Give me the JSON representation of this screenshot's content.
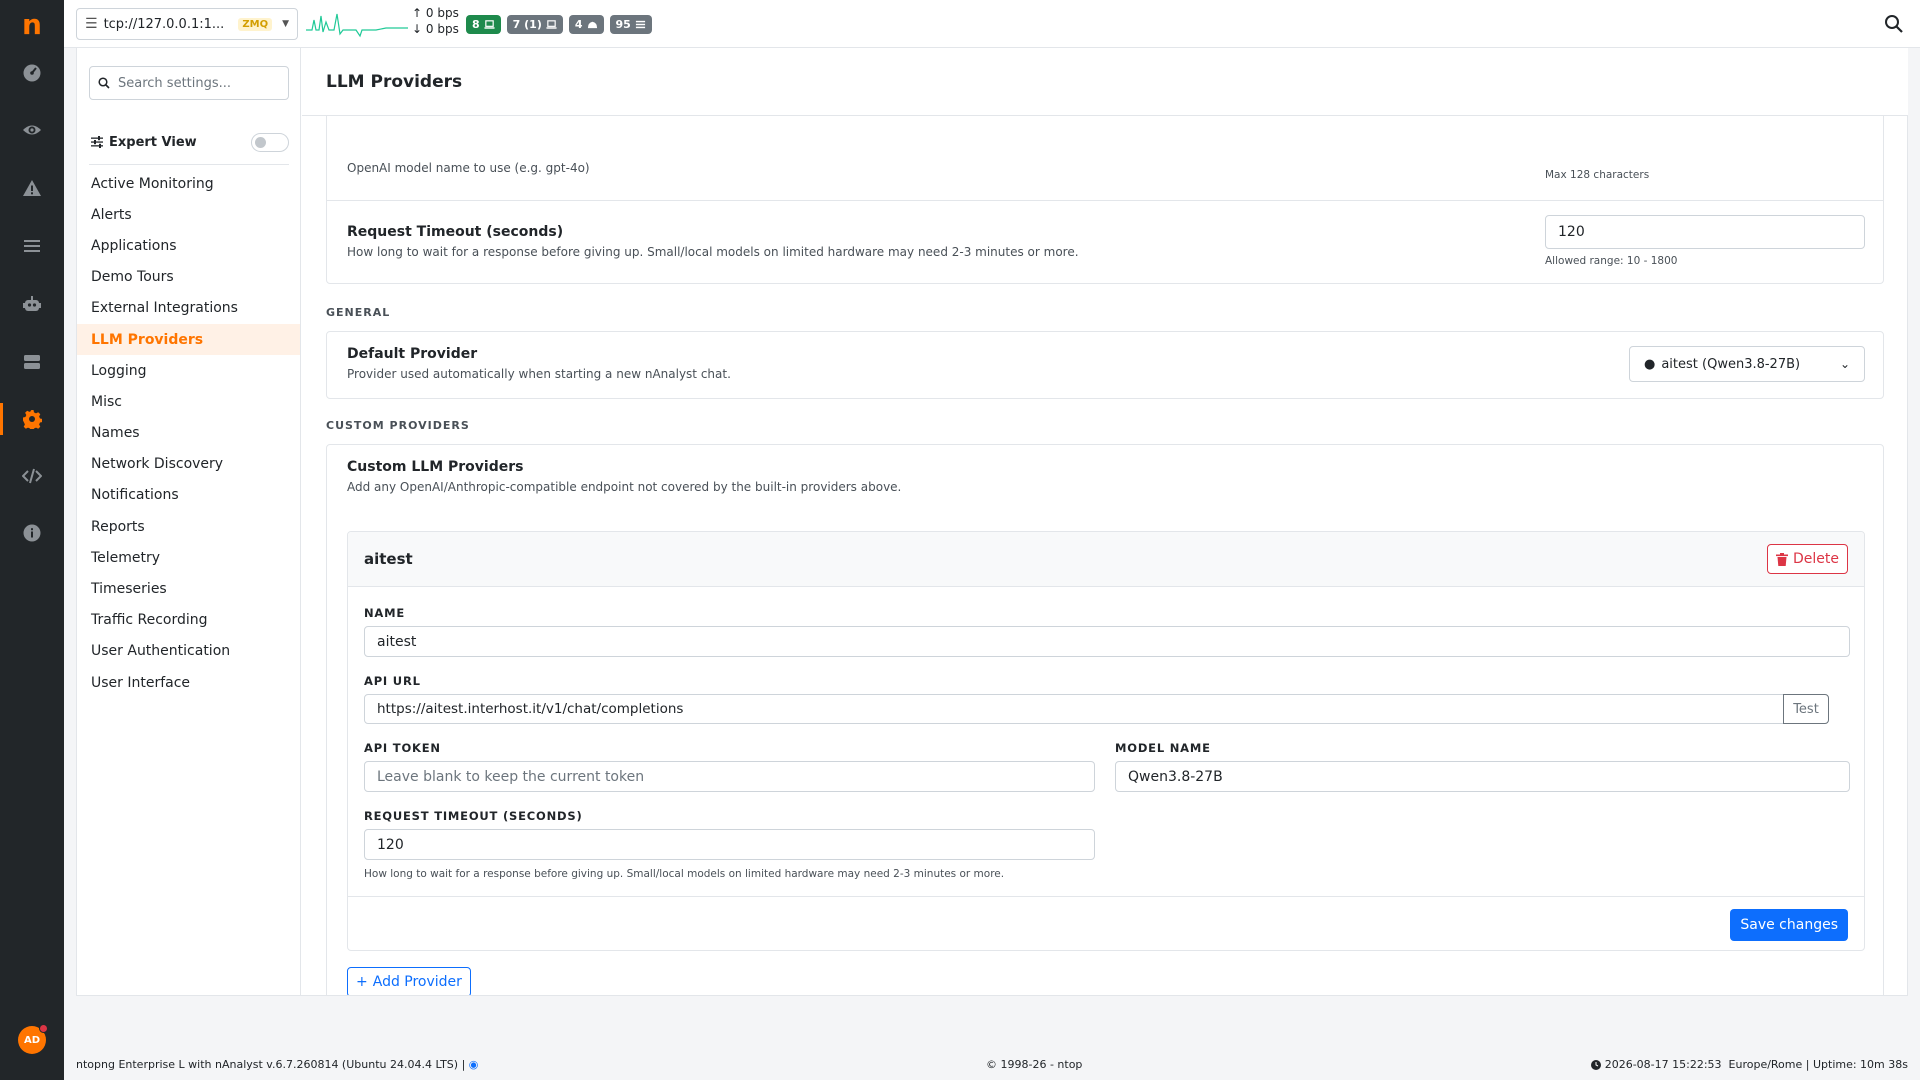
{
  "app": {
    "logo": "n",
    "avatar_initials": "AD"
  },
  "rail": {
    "icons": [
      "dashboard-icon",
      "eye-icon",
      "alert-icon",
      "list-icon",
      "robot-icon",
      "server-icon",
      "gear-icon",
      "code-icon",
      "info-icon"
    ],
    "active": "gear-icon",
    "accent_color": "#ff7500"
  },
  "topbar": {
    "interface": "tcp://127.0.0.1:1...",
    "interface_badge": "ZMQ",
    "upload": "0 bps",
    "download": "0 bps",
    "badges": [
      {
        "label": "8",
        "icon": "laptop-icon",
        "color": "#1e8a4c"
      },
      {
        "label": "7 (1)",
        "icon": "laptop-icon",
        "color": "#6c757d"
      },
      {
        "label": "4",
        "icon": "cloud-icon",
        "color": "#6c757d"
      },
      {
        "label": "95",
        "icon": "list-icon",
        "color": "#6c757d"
      }
    ]
  },
  "settings_nav": {
    "search_placeholder": "Search settings...",
    "expert_view_label": "Expert View",
    "expert_view_enabled": false,
    "items": [
      "Active Monitoring",
      "Alerts",
      "Applications",
      "Demo Tours",
      "External Integrations",
      "LLM Providers",
      "Logging",
      "Misc",
      "Names",
      "Network Discovery",
      "Notifications",
      "Reports",
      "Telemetry",
      "Timeseries",
      "Traffic Recording",
      "User Authentication",
      "User Interface"
    ],
    "active_item": "LLM Providers"
  },
  "page": {
    "title": "LLM Providers",
    "model_row": {
      "desc_partial": "OpenAI model name to use (e.g. gpt-4o)",
      "hint": "Max 128 characters"
    },
    "timeout_row": {
      "title": "Request Timeout (seconds)",
      "desc": "How long to wait for a response before giving up. Small/local models on limited hardware may need 2-3 minutes or more.",
      "value": "120",
      "hint": "Allowed range: 10 - 1800"
    },
    "general_section": "GENERAL",
    "default_provider": {
      "title": "Default Provider",
      "desc": "Provider used automatically when starting a new nAnalyst chat.",
      "selected": "aitest (Qwen3.8-27B)"
    },
    "custom_section": "CUSTOM PROVIDERS",
    "custom": {
      "title": "Custom LLM Providers",
      "desc": "Add any OpenAI/Anthropic-compatible endpoint not covered by the built-in providers above.",
      "provider": {
        "name": "aitest",
        "delete_label": "Delete",
        "name_label": "NAME",
        "name_value": "aitest",
        "api_url_label": "API URL",
        "api_url_value": "https://aitest.interhost.it/v1/chat/completions",
        "test_label": "Test",
        "api_token_label": "API TOKEN",
        "api_token_placeholder": "Leave blank to keep the current token",
        "model_name_label": "MODEL NAME",
        "model_name_value": "Qwen3.8-27B",
        "timeout_label": "REQUEST TIMEOUT (SECONDS)",
        "timeout_value": "120",
        "timeout_hint": "How long to wait for a response before giving up. Small/local models on limited hardware may need 2-3 minutes or more.",
        "save_label": "Save changes"
      },
      "add_label": "Add Provider"
    }
  },
  "footer": {
    "version": "ntopng Enterprise L with nAnalyst v.6.7.260814 (Ubuntu 24.04.4 LTS) |",
    "copyright": "© 1998-26 - ntop",
    "status": "2026-08-17 15:22:53  Europe/Rome | Uptime: 10m 38s"
  }
}
